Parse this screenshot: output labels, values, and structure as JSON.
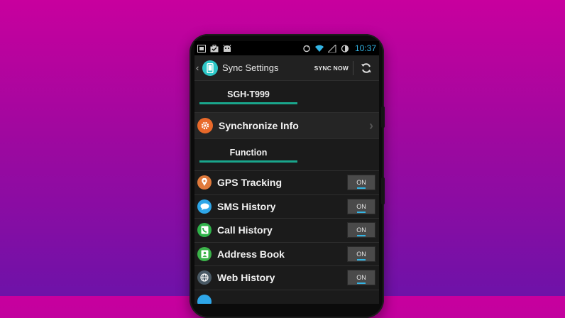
{
  "status_bar": {
    "time": "10:37",
    "left_icons": [
      "screenshot-icon",
      "briefcase-icon",
      "android-icon"
    ],
    "right_icons": [
      "sync-status-icon",
      "wifi-icon",
      "signal-icon",
      "battery-icon"
    ]
  },
  "action_bar": {
    "title": "Sync Settings",
    "sync_now_label": "SYNC NOW",
    "app_icon": "phone-icon"
  },
  "device_section": {
    "label": "SGH-T999"
  },
  "synchronize": {
    "label": "Synchronize Info",
    "icon": "gear-icon",
    "icon_color": "#e8692a"
  },
  "function_section": {
    "label": "Function"
  },
  "functions": [
    {
      "label": "GPS Tracking",
      "state": "ON",
      "icon": "location-icon",
      "icon_color": "#e07a3c"
    },
    {
      "label": "SMS History",
      "state": "ON",
      "icon": "chat-icon",
      "icon_color": "#2ea6e8"
    },
    {
      "label": "Call History",
      "state": "ON",
      "icon": "phone-call-icon",
      "icon_color": "#2fb34a"
    },
    {
      "label": "Address Book",
      "state": "ON",
      "icon": "contacts-icon",
      "icon_color": "#3cb34a"
    },
    {
      "label": "Web History",
      "state": "ON",
      "icon": "globe-icon",
      "icon_color": "#4a5a66"
    }
  ],
  "colors": {
    "accent_teal": "#1aa68c",
    "holo_blue": "#33b5e5",
    "background_magenta": "#c8009e",
    "background_purple": "#6e12a8"
  }
}
